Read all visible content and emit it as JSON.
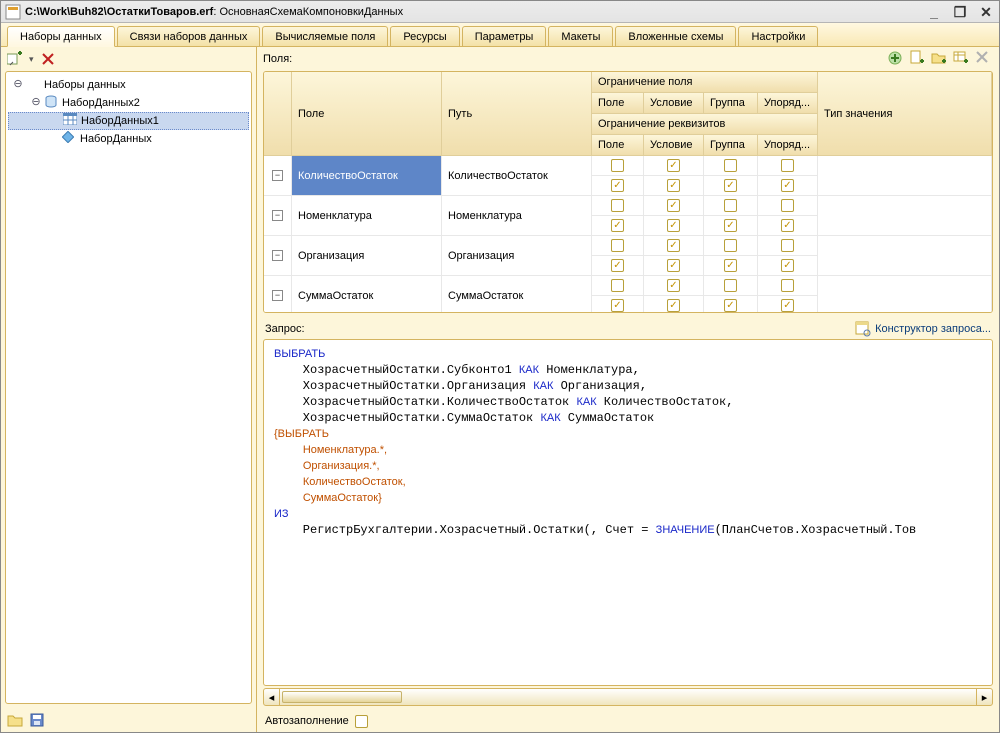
{
  "window": {
    "title_prefix": "C:\\Work\\Buh82\\ОстаткиТоваров.erf",
    "title_suffix": ": ОсновнаяСхемаКомпоновкиДанных"
  },
  "tabs": [
    {
      "label": "Наборы данных",
      "active": true
    },
    {
      "label": "Связи наборов данных"
    },
    {
      "label": "Вычисляемые поля"
    },
    {
      "label": "Ресурсы"
    },
    {
      "label": "Параметры"
    },
    {
      "label": "Макеты"
    },
    {
      "label": "Вложенные схемы"
    },
    {
      "label": "Настройки"
    }
  ],
  "tree": {
    "root_label": "Наборы данных",
    "nodes": [
      {
        "label": "НаборДанных2",
        "expanded": true,
        "icon": "cylinder",
        "children": [
          {
            "label": "НаборДанных1",
            "icon": "grid",
            "selected": true
          },
          {
            "label": "НаборДанных",
            "icon": "diamond"
          }
        ]
      }
    ]
  },
  "fields_label": "Поля:",
  "grid_headers": {
    "pole": "Поле",
    "put": "Путь",
    "ogr_pole": "Ограничение поля",
    "ogr_rek": "Ограничение реквизитов",
    "sub_pole": "Поле",
    "sub_usl": "Условие",
    "sub_gru": "Группа",
    "sub_upo": "Упоряд...",
    "tip": "Тип значения"
  },
  "rows": [
    {
      "field": "КоличествоОстаток",
      "path": "КоличествоОстаток",
      "r1": [
        false,
        true,
        false,
        false
      ],
      "r2": [
        true,
        true,
        true,
        true
      ],
      "selected": true
    },
    {
      "field": "Номенклатура",
      "path": "Номенклатура",
      "r1": [
        false,
        true,
        false,
        false
      ],
      "r2": [
        true,
        true,
        true,
        true
      ]
    },
    {
      "field": "Организация",
      "path": "Организация",
      "r1": [
        false,
        true,
        false,
        false
      ],
      "r2": [
        true,
        true,
        true,
        true
      ]
    },
    {
      "field": "СуммаОстаток",
      "path": "СуммаОстаток",
      "r1": [
        false,
        true,
        false,
        false
      ],
      "r2": [
        true,
        true,
        true,
        true
      ]
    }
  ],
  "query_label": "Запрос:",
  "query_builder": "Конструктор запроса...",
  "query_lines": [
    {
      "indent": 0,
      "parts": [
        {
          "t": "ВЫБРАТЬ",
          "c": "kw"
        }
      ]
    },
    {
      "indent": 1,
      "parts": [
        {
          "t": "ХозрасчетныйОстатки.Субконто1 "
        },
        {
          "t": "КАК",
          "c": "kw"
        },
        {
          "t": " Номенклатура,"
        }
      ]
    },
    {
      "indent": 1,
      "parts": [
        {
          "t": "ХозрасчетныйОстатки.Организация "
        },
        {
          "t": "КАК",
          "c": "kw"
        },
        {
          "t": " Организация,"
        }
      ]
    },
    {
      "indent": 1,
      "parts": [
        {
          "t": "ХозрасчетныйОстатки.КоличествоОстаток "
        },
        {
          "t": "КАК",
          "c": "kw"
        },
        {
          "t": " КоличествоОстаток,"
        }
      ]
    },
    {
      "indent": 1,
      "parts": [
        {
          "t": "ХозрасчетныйОстатки.СуммаОстаток "
        },
        {
          "t": "КАК",
          "c": "kw"
        },
        {
          "t": " СуммаОстаток"
        }
      ]
    },
    {
      "indent": 0,
      "parts": [
        {
          "t": "{ВЫБРАТЬ",
          "c": "brace"
        }
      ]
    },
    {
      "indent": 1,
      "parts": [
        {
          "t": "Номенклатура.*,",
          "c": "brace"
        }
      ]
    },
    {
      "indent": 1,
      "parts": [
        {
          "t": "Организация.*,",
          "c": "brace"
        }
      ]
    },
    {
      "indent": 1,
      "parts": [
        {
          "t": "КоличествоОстаток,",
          "c": "brace"
        }
      ]
    },
    {
      "indent": 1,
      "parts": [
        {
          "t": "СуммаОстаток}",
          "c": "brace"
        }
      ]
    },
    {
      "indent": 0,
      "parts": [
        {
          "t": "ИЗ",
          "c": "kw"
        }
      ]
    },
    {
      "indent": 1,
      "parts": [
        {
          "t": "РегистрБухгалтерии.Хозрасчетный.Остатки(, Счет = "
        },
        {
          "t": "ЗНАЧЕНИЕ",
          "c": "kw"
        },
        {
          "t": "(ПланСчетов.Хозрасчетный.Тов"
        }
      ]
    }
  ],
  "autofill_label": "Автозаполнение"
}
